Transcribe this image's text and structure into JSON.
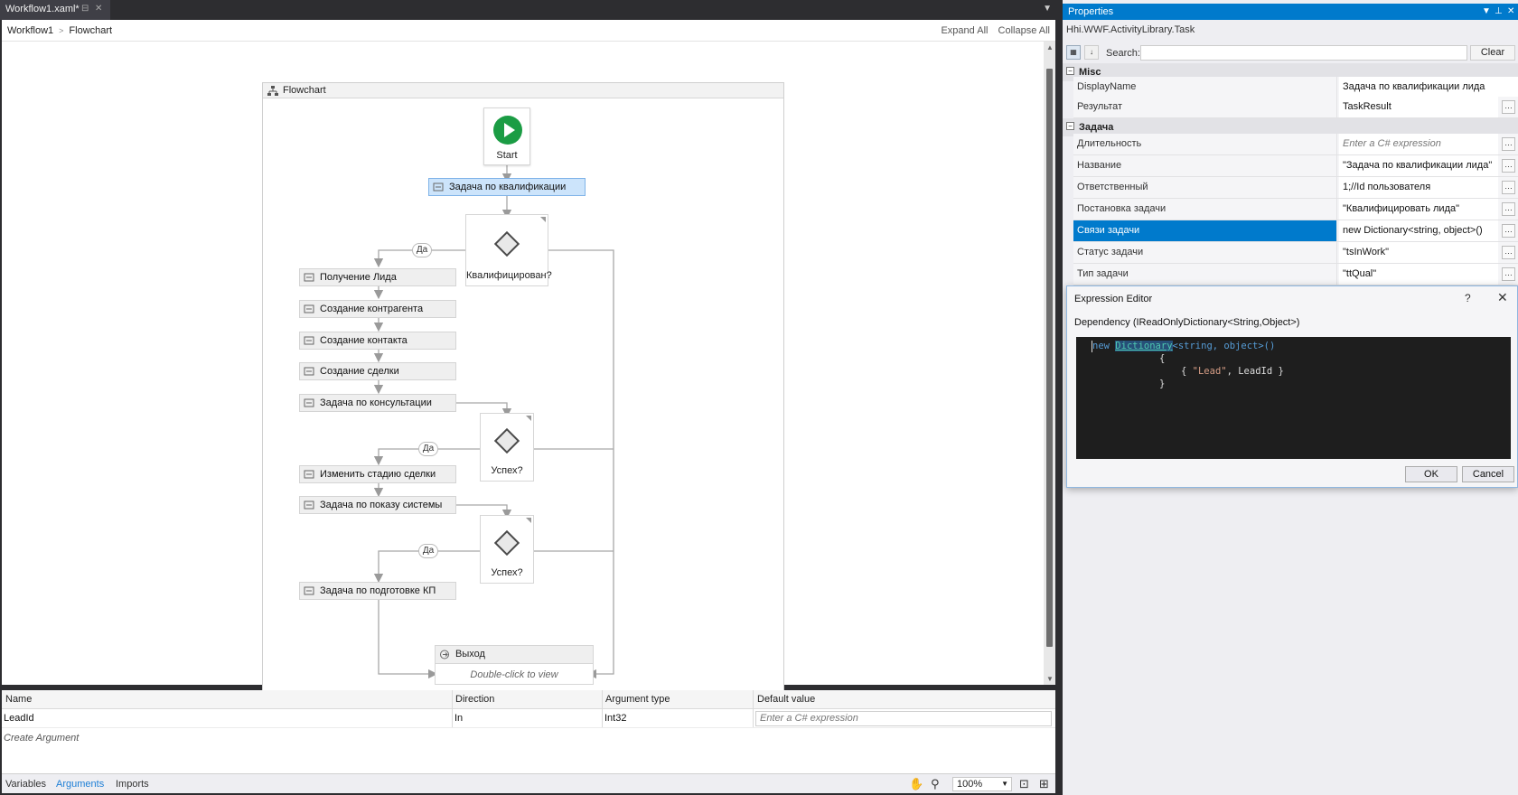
{
  "document": {
    "tab_title": "Workflow1.xaml*",
    "breadcrumb": [
      "Workflow1",
      "Flowchart"
    ],
    "expand_all": "Expand All",
    "collapse_all": "Collapse All"
  },
  "flowchart": {
    "title": "Flowchart",
    "start_label": "Start",
    "selected_activity": "Задача по квалификации",
    "decisions": [
      "Квалифицирован?",
      "Успех?",
      "Успех?"
    ],
    "yes_label": "Да",
    "activities": [
      "Получение Лида",
      "Создание контрагента",
      "Создание контакта",
      "Создание сделки",
      "Задача по консультации",
      "Изменить стадию сделки",
      "Задача по показу системы",
      "Задача по подготовке КП"
    ],
    "exit_label": "Выход",
    "exit_hint": "Double-click to view"
  },
  "arguments": {
    "columns": [
      "Name",
      "Direction",
      "Argument type",
      "Default value"
    ],
    "rows": [
      {
        "name": "LeadId",
        "direction": "In",
        "type": "Int32",
        "default_placeholder": "Enter a C# expression"
      }
    ],
    "create_label": "Create Argument"
  },
  "bottom_bar": {
    "tabs": [
      "Variables",
      "Arguments",
      "Imports"
    ],
    "active_tab": "Arguments",
    "zoom": "100%"
  },
  "properties": {
    "title": "Properties",
    "type_name": "Hhi.WWF.ActivityLibrary.Task",
    "search_label": "Search:",
    "clear_label": "Clear",
    "categories": [
      {
        "name": "Misc",
        "items": [
          {
            "name": "DisplayName",
            "value": "Задача по квалификации лида"
          },
          {
            "name": "Результат",
            "value": "TaskResult"
          }
        ]
      },
      {
        "name": "Задача",
        "items": [
          {
            "name": "Длительность",
            "value": "Enter a C# expression"
          },
          {
            "name": "Название",
            "value": "\"Задача по квалификации лида\""
          },
          {
            "name": "Ответственный",
            "value": "1;//Id пользователя"
          },
          {
            "name": "Постановка задачи",
            "value": "\"Квалифицировать лида\""
          },
          {
            "name": "Связи задачи",
            "value": "new Dictionary<string, object>()"
          },
          {
            "name": "Статус задачи",
            "value": "\"tsInWork\""
          },
          {
            "name": "Тип задачи",
            "value": "\"ttQual\""
          }
        ]
      }
    ],
    "selected_property": "Связи задачи"
  },
  "expression_editor": {
    "title": "Expression Editor",
    "help": "?",
    "dependency_label": "Dependency (IReadOnlyDictionary<String,Object>)",
    "code": {
      "kw_new": "new",
      "type_name": "Dictionary",
      "generic": "<string, object>()",
      "open_brace": "{",
      "entry_open": "{ ",
      "entry_key": "\"Lead\"",
      "entry_rest": ", LeadId }",
      "close_brace": "}"
    },
    "ok_label": "OK",
    "cancel_label": "Cancel"
  },
  "colors": {
    "accent": "#007acc",
    "selection": "#cce4fb",
    "start_green": "#1b9c44",
    "code_bg": "#1e1e1e"
  }
}
